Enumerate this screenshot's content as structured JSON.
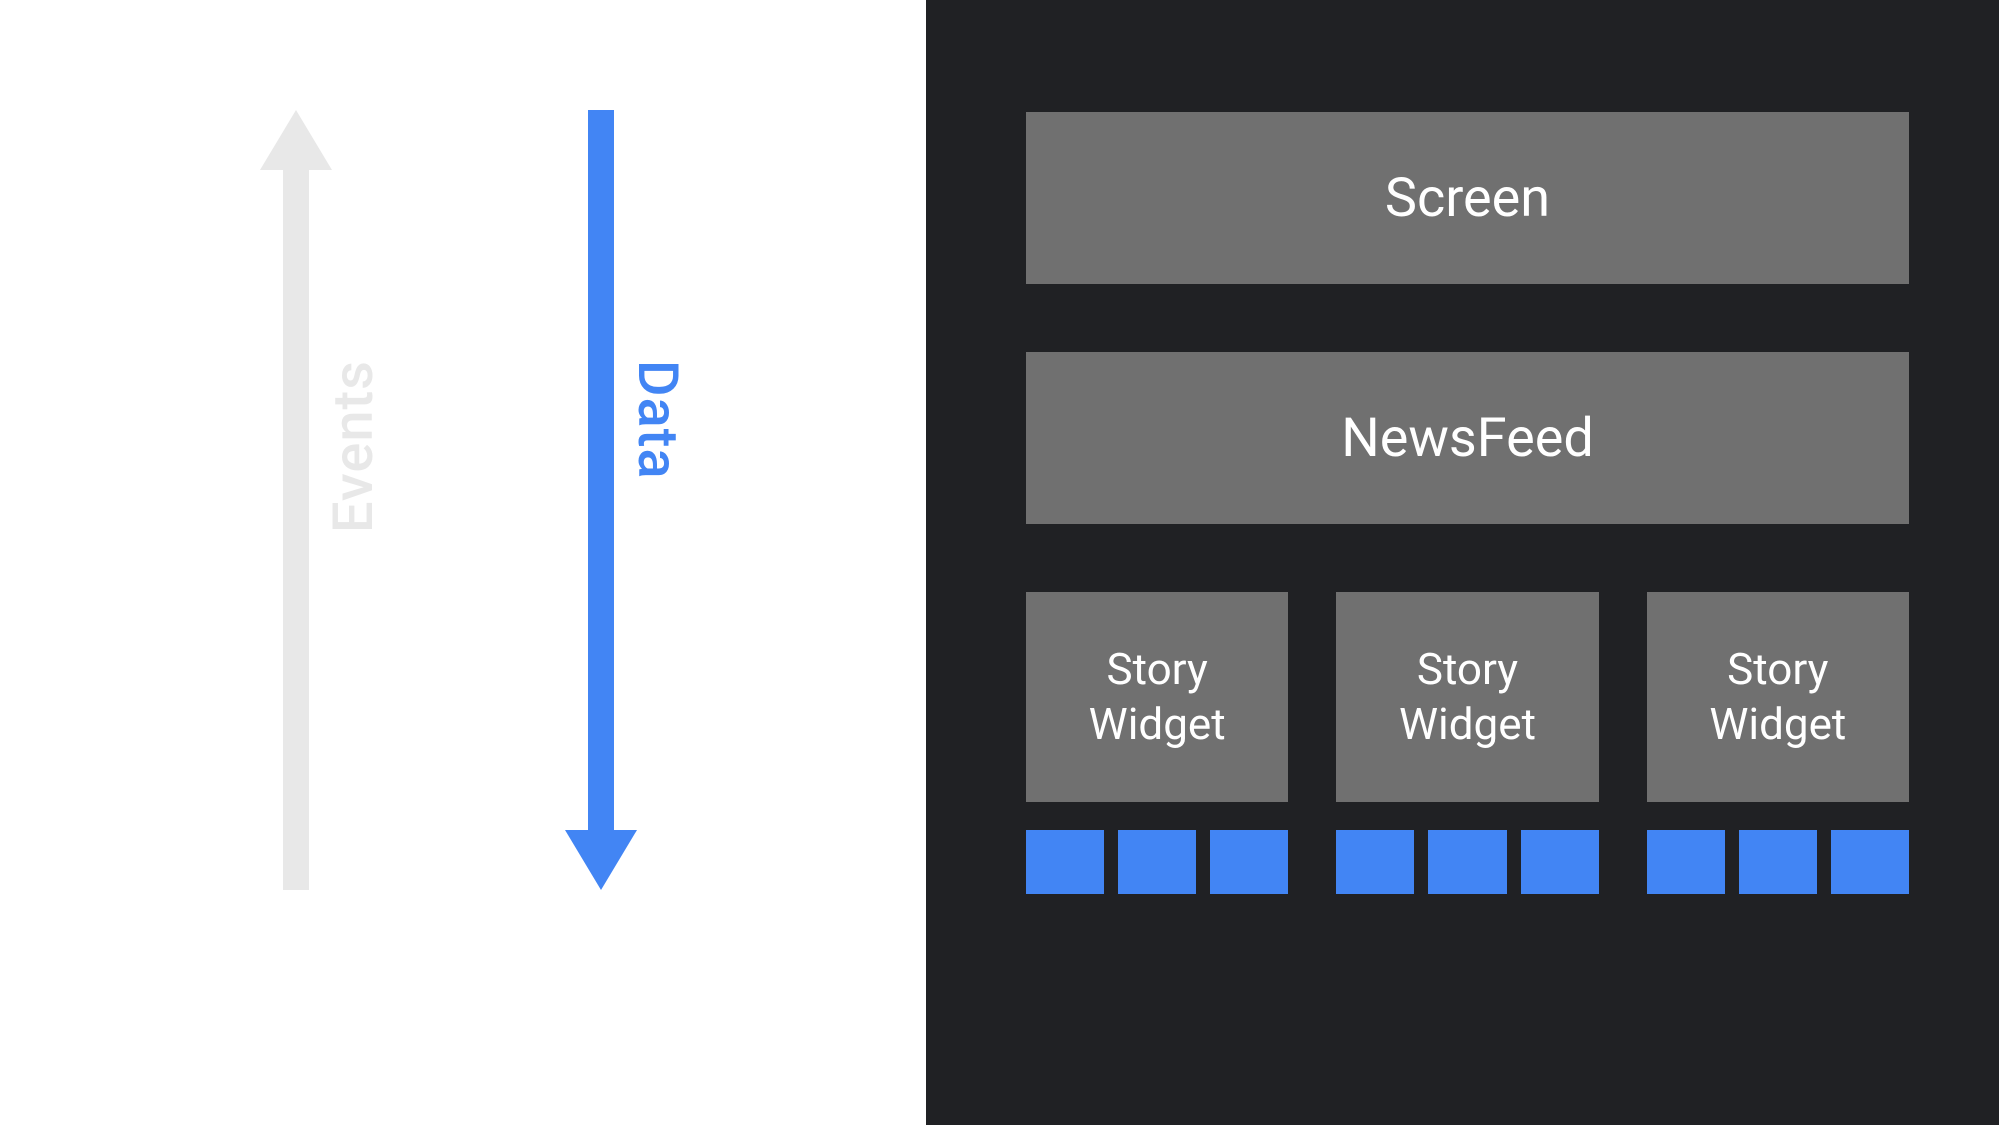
{
  "arrows": {
    "events_label": "Events",
    "data_label": "Data"
  },
  "hierarchy": {
    "screen_label": "Screen",
    "newsfeed_label": "NewsFeed",
    "widgets": [
      {
        "label": "Story\nWidget",
        "chips": 3
      },
      {
        "label": "Story\nWidget",
        "chips": 3
      },
      {
        "label": "Story\nWidget",
        "chips": 3
      }
    ]
  },
  "colors": {
    "events_arrow": "#e8e8e8",
    "data_arrow": "#4285f4",
    "block_bg": "#707070",
    "chip_bg": "#4285f4",
    "right_bg": "#202124"
  }
}
